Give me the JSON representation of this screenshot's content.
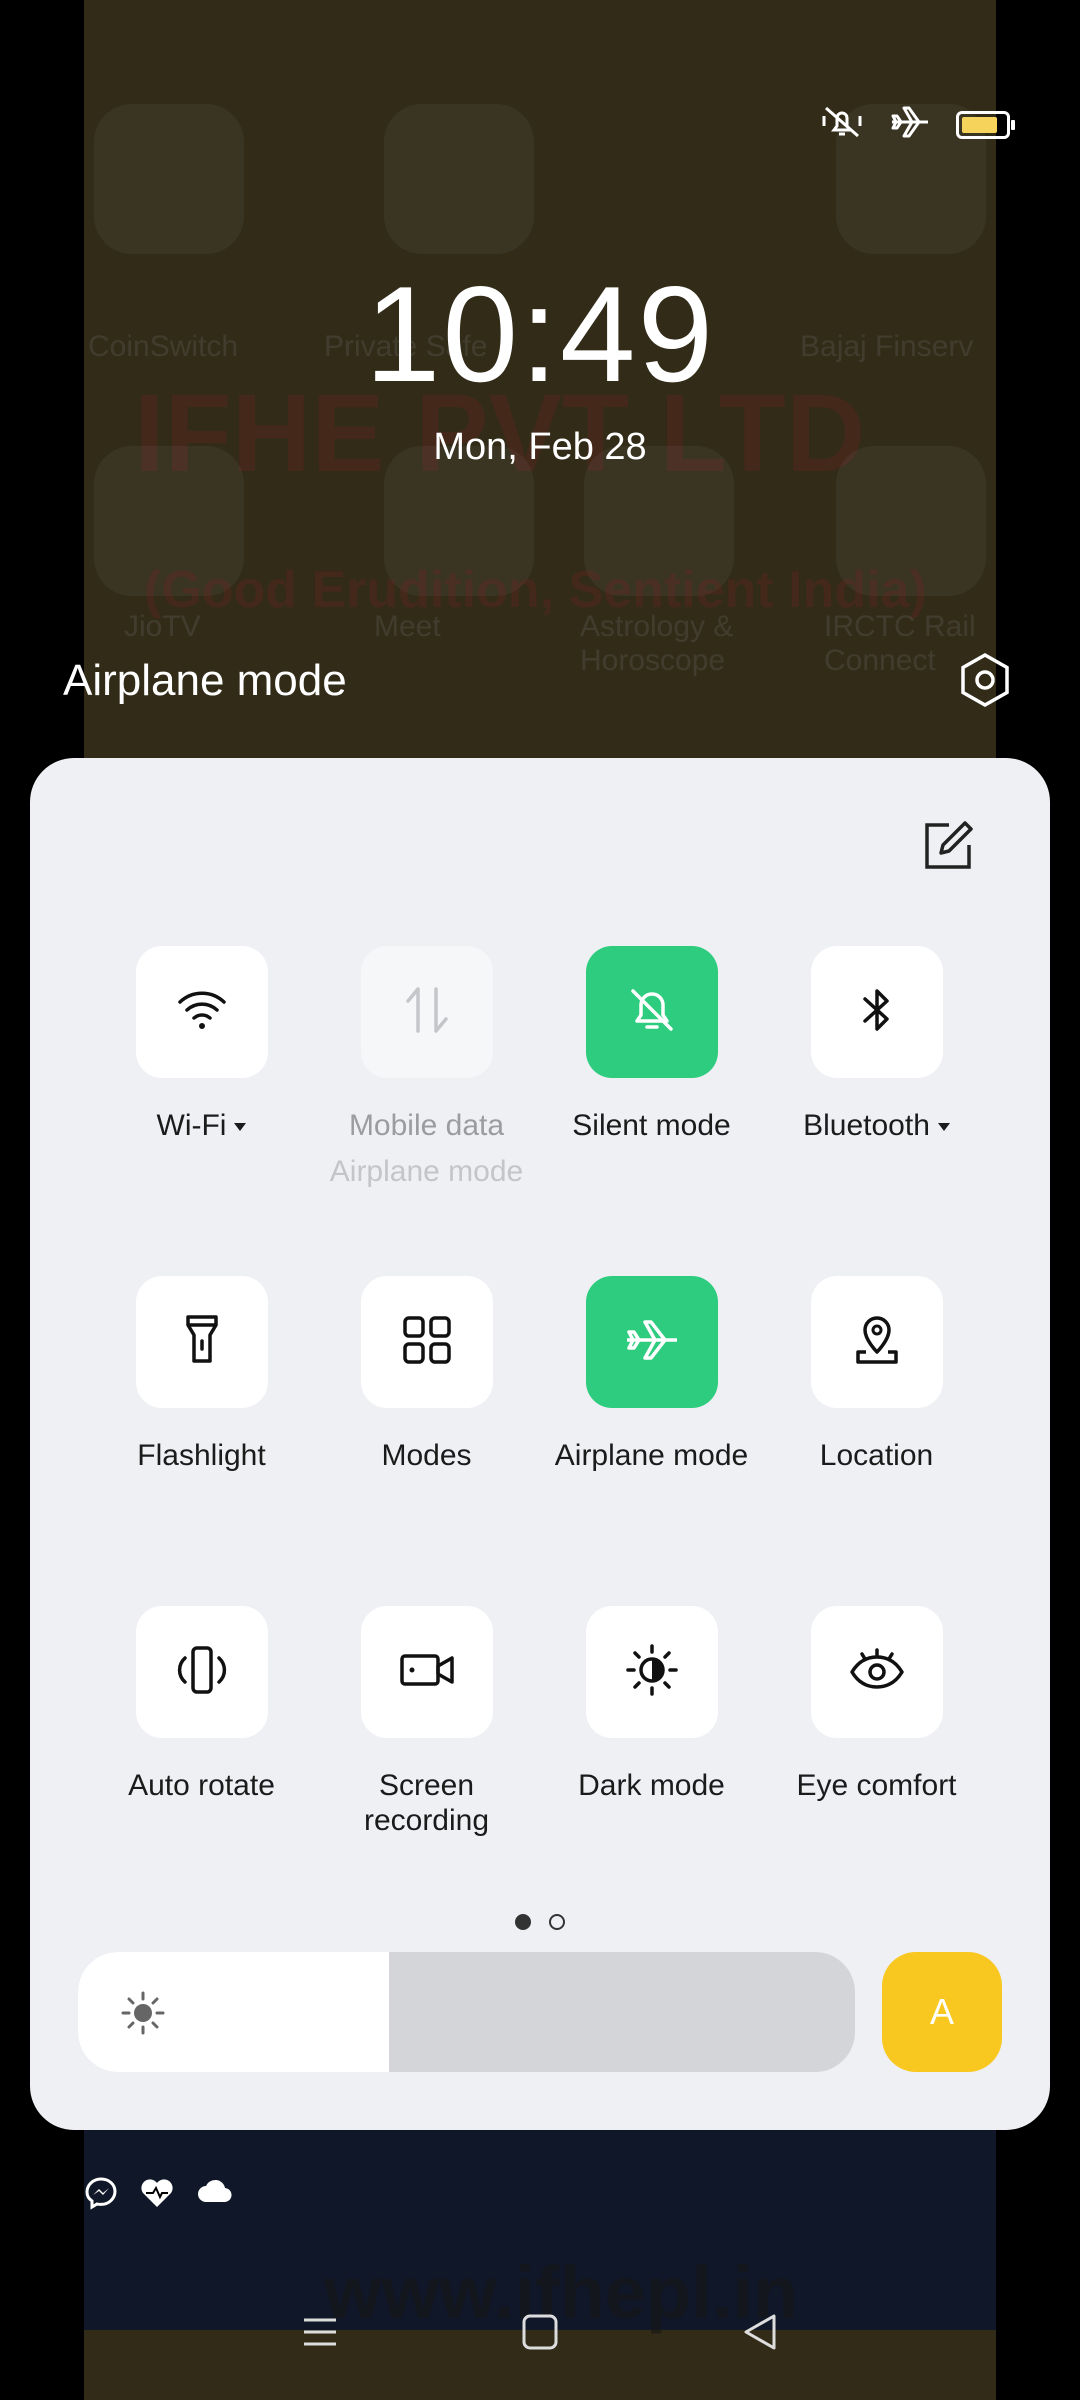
{
  "status_bar": {
    "icons": [
      "silent-bell-icon",
      "airplane-icon",
      "battery-icon"
    ],
    "battery_level": 0.72,
    "battery_color": "#f6d35a"
  },
  "lockscreen": {
    "time": "10:49",
    "date": "Mon, Feb 28"
  },
  "panel_header": {
    "title": "Airplane mode",
    "settings_icon": "gear-icon",
    "edit_icon": "edit-icon"
  },
  "tiles": [
    {
      "label": "Wi-Fi",
      "icon": "wifi-icon",
      "state": "off",
      "dropdown": true
    },
    {
      "label": "Mobile data",
      "sublabel": "Airplane mode",
      "icon": "mobile-data-icon",
      "state": "disabled"
    },
    {
      "label": "Silent mode",
      "icon": "silent-bell-icon",
      "state": "on"
    },
    {
      "label": "Bluetooth",
      "icon": "bluetooth-icon",
      "state": "off",
      "dropdown": true
    },
    {
      "label": "Flashlight",
      "icon": "flashlight-icon",
      "state": "off"
    },
    {
      "label": "Modes",
      "icon": "modes-grid-icon",
      "state": "off"
    },
    {
      "label": "Airplane mode",
      "icon": "airplane-icon",
      "state": "on"
    },
    {
      "label": "Location",
      "icon": "location-pin-icon",
      "state": "off"
    },
    {
      "label": "Auto rotate",
      "icon": "auto-rotate-icon",
      "state": "off"
    },
    {
      "label": "Screen recording",
      "icon": "screen-recording-icon",
      "state": "off"
    },
    {
      "label": "Dark mode",
      "icon": "dark-mode-icon",
      "state": "off"
    },
    {
      "label": "Eye comfort",
      "icon": "eye-comfort-icon",
      "state": "off"
    }
  ],
  "pager": {
    "pages": 2,
    "current": 1
  },
  "brightness": {
    "level": 0.4,
    "auto_label": "A",
    "auto_color": "#f9c820"
  },
  "accent_on": "#2ecc7e",
  "notifications": [
    "messenger-icon",
    "heart-icon",
    "cloud-icon"
  ],
  "nav_bar": [
    "menu-icon",
    "home-icon",
    "back-icon"
  ],
  "wallpaper": {
    "apps": [
      "CoinSwitch",
      "Private Safe",
      "Bajaj Finserv",
      "JioTV",
      "Meet",
      "Astrology & Horoscope",
      "IRCTC Rail Connect"
    ],
    "banner": "IFHE PVT LTD",
    "tagline": "(Good Erudition, Sentient India)",
    "url": "www.ifhepl.in"
  }
}
